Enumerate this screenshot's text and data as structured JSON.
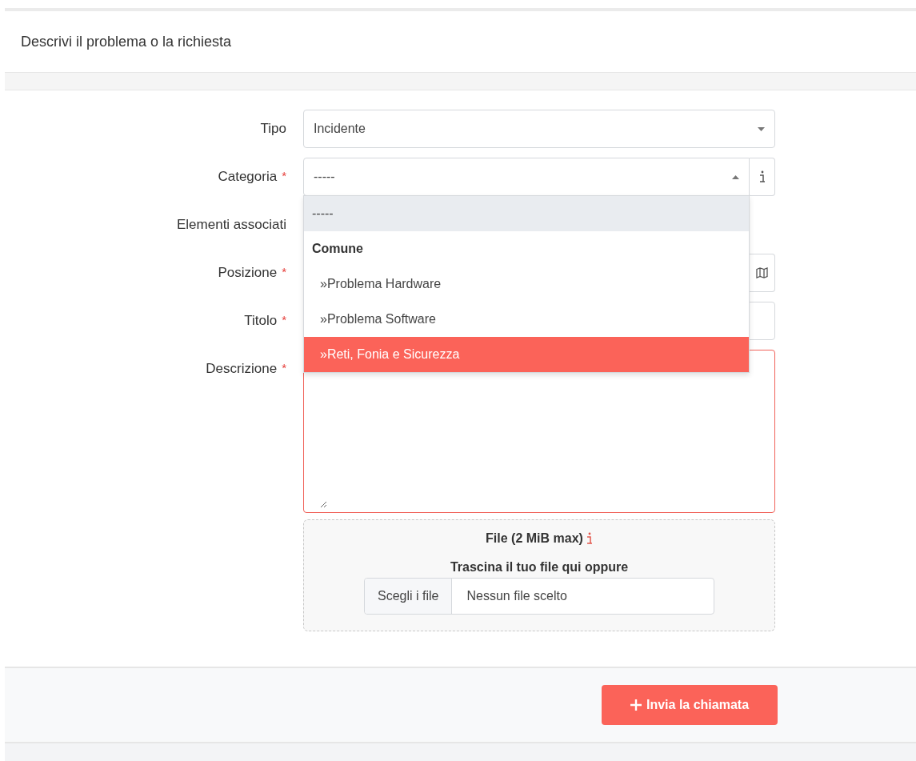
{
  "header": {
    "title": "Descrivi il problema o la richiesta"
  },
  "fields": [
    {
      "label": "Tipo",
      "kind": "select",
      "value": "Incidente",
      "open": false
    },
    {
      "label": "Categoria",
      "required_mark": "*",
      "kind": "select-info",
      "value": "-----",
      "open": true
    },
    {
      "label": "Elementi associati",
      "kind": "covered"
    },
    {
      "label": "Posizione",
      "required_mark": "*",
      "kind": "input-map"
    },
    {
      "label": "Titolo",
      "required_mark": "*",
      "kind": "input"
    },
    {
      "label": "Descrizione",
      "required_mark": "*",
      "kind": "textarea",
      "invalid": true
    }
  ],
  "dropdown": {
    "options": [
      {
        "kind": "option",
        "text": "-----",
        "selected": true,
        "highlighted": false
      },
      {
        "kind": "group",
        "text": "Comune"
      },
      {
        "kind": "option",
        "text": "»Problema Hardware",
        "selected": false,
        "highlighted": false
      },
      {
        "kind": "option",
        "text": "»Problema Software",
        "selected": false,
        "highlighted": false
      },
      {
        "kind": "option",
        "text": "»Reti, Fonia e Sicurezza",
        "selected": false,
        "highlighted": true
      }
    ]
  },
  "upload": {
    "title": "File (2 MiB max)",
    "hint": "Trascina il tuo file qui oppure",
    "button": "Scegli i file",
    "status": "Nessun file scelto"
  },
  "submit": {
    "label": "Invia la chiamata"
  }
}
